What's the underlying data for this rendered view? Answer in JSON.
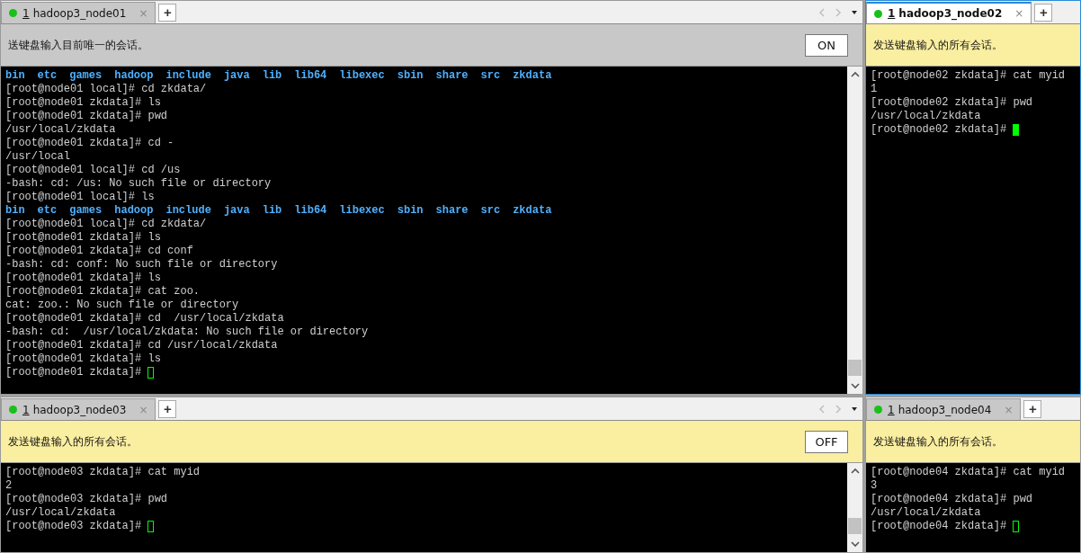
{
  "panes": [
    {
      "tab": {
        "number": "1",
        "title": "hadoop3_node01",
        "close": "×",
        "selected": false
      },
      "add": "+",
      "nav_arrows": true,
      "banner": {
        "text": "送键盘输入目前唯一的会话。",
        "highlighted": false,
        "toggle": "ON"
      },
      "scrollbar": true,
      "lines": [
        {
          "kind": "ls",
          "items": [
            "bin",
            "etc",
            "games",
            "hadoop",
            "include",
            "java",
            "lib",
            "lib64",
            "libexec",
            "sbin",
            "share",
            "src",
            "zkdata"
          ]
        },
        {
          "kind": "text",
          "text": "[root@node01 local]# cd zkdata/"
        },
        {
          "kind": "text",
          "text": "[root@node01 zkdata]# ls"
        },
        {
          "kind": "text",
          "text": "[root@node01 zkdata]# pwd"
        },
        {
          "kind": "text",
          "text": "/usr/local/zkdata"
        },
        {
          "kind": "text",
          "text": "[root@node01 zkdata]# cd -"
        },
        {
          "kind": "text",
          "text": "/usr/local"
        },
        {
          "kind": "text",
          "text": "[root@node01 local]# cd /us"
        },
        {
          "kind": "text",
          "text": "-bash: cd: /us: No such file or directory"
        },
        {
          "kind": "text",
          "text": "[root@node01 local]# ls"
        },
        {
          "kind": "ls",
          "items": [
            "bin",
            "etc",
            "games",
            "hadoop",
            "include",
            "java",
            "lib",
            "lib64",
            "libexec",
            "sbin",
            "share",
            "src",
            "zkdata"
          ]
        },
        {
          "kind": "text",
          "text": "[root@node01 local]# cd zkdata/"
        },
        {
          "kind": "text",
          "text": "[root@node01 zkdata]# ls"
        },
        {
          "kind": "text",
          "text": "[root@node01 zkdata]# cd conf"
        },
        {
          "kind": "text",
          "text": "-bash: cd: conf: No such file or directory"
        },
        {
          "kind": "text",
          "text": "[root@node01 zkdata]# ls"
        },
        {
          "kind": "text",
          "text": "[root@node01 zkdata]# cat zoo."
        },
        {
          "kind": "text",
          "text": "cat: zoo.: No such file or directory"
        },
        {
          "kind": "text",
          "text": "[root@node01 zkdata]# cd  /usr/local/zkdata"
        },
        {
          "kind": "text",
          "text": "-bash: cd:  /usr/local/zkdata: No such file or directory"
        },
        {
          "kind": "text",
          "text": "[root@node01 zkdata]# cd /usr/local/zkdata"
        },
        {
          "kind": "text",
          "text": "[root@node01 zkdata]# ls"
        },
        {
          "kind": "prompt",
          "text": "[root@node01 zkdata]#",
          "cursor_filled": false
        }
      ]
    },
    {
      "tab": {
        "number": "1",
        "title": "hadoop3_node02",
        "close": "×",
        "selected": true
      },
      "add": "+",
      "nav_arrows": false,
      "banner": {
        "text": "发送键盘输入的所有会话。",
        "highlighted": true
      },
      "scrollbar": false,
      "lines": [
        {
          "kind": "text",
          "text": "[root@node02 zkdata]# cat myid"
        },
        {
          "kind": "text",
          "text": "1"
        },
        {
          "kind": "text",
          "text": "[root@node02 zkdata]# pwd"
        },
        {
          "kind": "text",
          "text": "/usr/local/zkdata"
        },
        {
          "kind": "prompt",
          "text": "[root@node02 zkdata]#",
          "cursor_filled": true
        }
      ]
    },
    {
      "tab": {
        "number": "1",
        "title": "hadoop3_node03",
        "close": "×",
        "selected": false
      },
      "add": "+",
      "nav_arrows": true,
      "banner": {
        "text": "发送键盘输入的所有会话。",
        "highlighted": true,
        "toggle": "OFF"
      },
      "scrollbar": true,
      "lines": [
        {
          "kind": "text",
          "text": "[root@node03 zkdata]# cat myid"
        },
        {
          "kind": "text",
          "text": "2"
        },
        {
          "kind": "text",
          "text": "[root@node03 zkdata]# pwd"
        },
        {
          "kind": "text",
          "text": "/usr/local/zkdata"
        },
        {
          "kind": "prompt",
          "text": "[root@node03 zkdata]#",
          "cursor_filled": false
        }
      ]
    },
    {
      "tab": {
        "number": "1",
        "title": "hadoop3_node04",
        "close": "×",
        "selected": false
      },
      "add": "+",
      "nav_arrows": false,
      "banner": {
        "text": "发送键盘输入的所有会话。",
        "highlighted": true
      },
      "scrollbar": false,
      "lines": [
        {
          "kind": "text",
          "text": "[root@node04 zkdata]# cat myid"
        },
        {
          "kind": "text",
          "text": "3"
        },
        {
          "kind": "text",
          "text": "[root@node04 zkdata]# pwd"
        },
        {
          "kind": "text",
          "text": "/usr/local/zkdata"
        },
        {
          "kind": "prompt",
          "text": "[root@node04 zkdata]#",
          "cursor_filled": false
        }
      ]
    }
  ]
}
